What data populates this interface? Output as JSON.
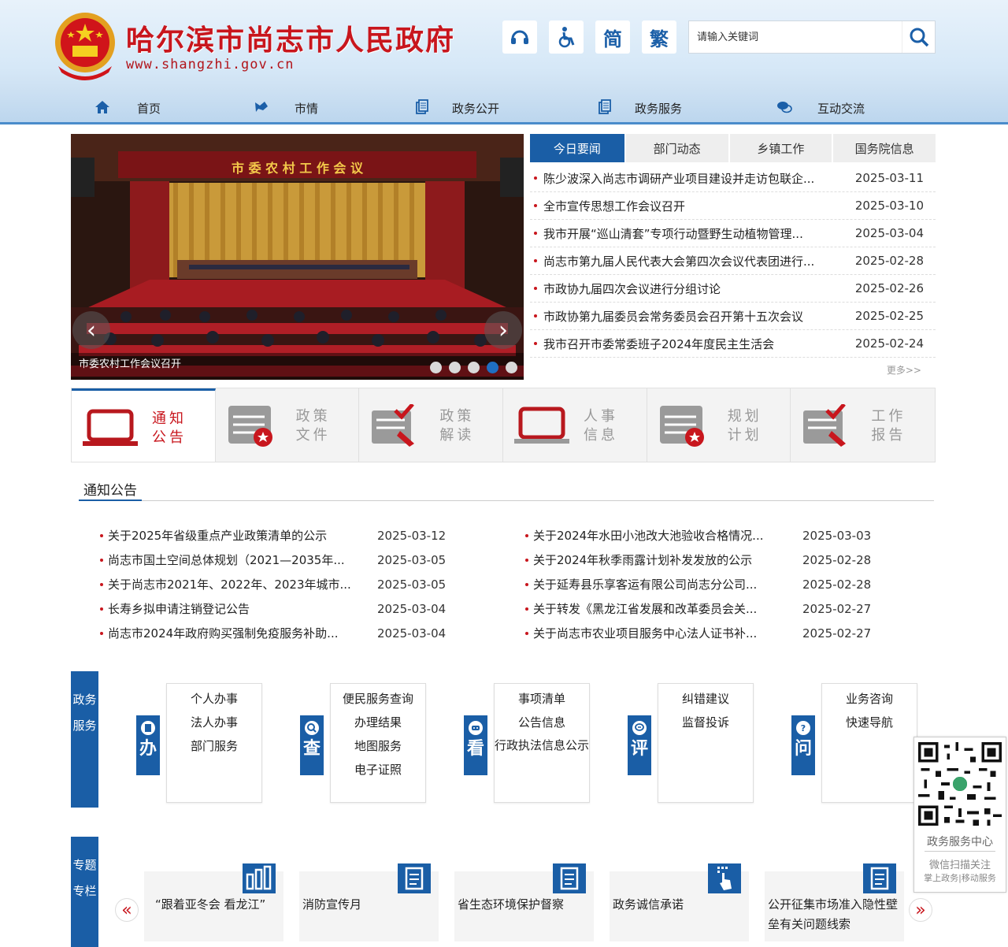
{
  "header": {
    "title": "哈尔滨市尚志市人民政府",
    "url": "www.shangzhi.gov.cn",
    "tools": {
      "simplified": "简",
      "traditional": "繁"
    },
    "search": {
      "placeholder": "请输入关键词"
    }
  },
  "nav": [
    {
      "label": "首页",
      "icon": "home-icon"
    },
    {
      "label": "市情",
      "icon": "city-icon"
    },
    {
      "label": "政务公开",
      "icon": "document-icon"
    },
    {
      "label": "政务服务",
      "icon": "service-icon"
    },
    {
      "label": "互动交流",
      "icon": "chat-icon"
    }
  ],
  "slider": {
    "banner_text": "市 委 农 村 工 作 会 议",
    "caption": "市委农村工作会议召开",
    "dots": 5,
    "active_dot": 4
  },
  "news": {
    "tabs": [
      "今日要闻",
      "部门动态",
      "乡镇工作",
      "国务院信息"
    ],
    "items": [
      {
        "title": "陈少波深入尚志市调研产业项目建设并走访包联企...",
        "date": "2025-03-11"
      },
      {
        "title": "全市宣传思想工作会议召开",
        "date": "2025-03-10"
      },
      {
        "title": "我市开展“巡山清套”专项行动暨野生动植物管理...",
        "date": "2025-03-04"
      },
      {
        "title": "尚志市第九届人民代表大会第四次会议代表团进行...",
        "date": "2025-02-28"
      },
      {
        "title": "市政协九届四次会议进行分组讨论",
        "date": "2025-02-26"
      },
      {
        "title": "市政协第九届委员会常务委员会召开第十五次会议",
        "date": "2025-02-25"
      },
      {
        "title": "我市召开市委常委班子2024年度民主生活会",
        "date": "2025-02-24"
      }
    ],
    "more": "更多>>"
  },
  "categories": [
    {
      "label": "通知公告",
      "active": true
    },
    {
      "label": "政策文件",
      "active": false
    },
    {
      "label": "政策解读",
      "active": false
    },
    {
      "label": "人事信息",
      "active": false
    },
    {
      "label": "规划计划",
      "active": false
    },
    {
      "label": "工作报告",
      "active": false
    }
  ],
  "notices": {
    "heading": "通知公告",
    "left": [
      {
        "title": "关于2025年省级重点产业政策清单的公示",
        "date": "2025-03-12"
      },
      {
        "title": "尚志市国土空间总体规划（2021—2035年...",
        "date": "2025-03-05"
      },
      {
        "title": "关于尚志市2021年、2022年、2023年城市...",
        "date": "2025-03-05"
      },
      {
        "title": "长寿乡拟申请注销登记公告",
        "date": "2025-03-04"
      },
      {
        "title": "尚志市2024年政府购买强制免疫服务补助...",
        "date": "2025-03-04"
      }
    ],
    "right": [
      {
        "title": "关于2024年水田小池改大池验收合格情况...",
        "date": "2025-03-03"
      },
      {
        "title": "关于2024年秋季雨露计划补发发放的公示",
        "date": "2025-02-28"
      },
      {
        "title": "关于延寿县乐享客运有限公司尚志分公司...",
        "date": "2025-02-28"
      },
      {
        "title": "关于转发《黑龙江省发展和改革委员会关...",
        "date": "2025-02-27"
      },
      {
        "title": "关于尚志市农业项目服务中心法人证书补...",
        "date": "2025-02-27"
      }
    ]
  },
  "services": {
    "side_label": "政务服务",
    "groups": [
      {
        "tag": "办",
        "items": [
          "个人办事",
          "法人办事",
          "部门服务"
        ]
      },
      {
        "tag": "查",
        "items": [
          "便民服务查询",
          "办理结果",
          "地图服务",
          "电子证照"
        ]
      },
      {
        "tag": "看",
        "items": [
          "事项清单",
          "公告信息",
          "行政执法信息公示"
        ]
      },
      {
        "tag": "评",
        "items": [
          "纠错建议",
          "监督投诉"
        ]
      },
      {
        "tag": "问",
        "items": [
          "业务咨询",
          "快速导航"
        ]
      }
    ]
  },
  "qr": {
    "title": "政务服务中心",
    "line2": "微信扫描关注",
    "line3": "掌上政务|移动服务"
  },
  "topics": {
    "side_label": "专题专栏",
    "cards": [
      {
        "title": "“跟着亚冬会 看龙江”",
        "icon": "bar-chart-icon"
      },
      {
        "title": "消防宣传月",
        "icon": "document-icon"
      },
      {
        "title": "省生态环境保护督察",
        "icon": "document-icon"
      },
      {
        "title": "政务诚信承诺",
        "icon": "hand-pointer-icon"
      },
      {
        "title": "公开征集市场准入隐性壁垒有关问题线索",
        "icon": "document-icon"
      }
    ],
    "prev": "«",
    "next": "»"
  },
  "colors": {
    "brand_red": "#c8161d",
    "brand_blue": "#1a5ea6"
  }
}
